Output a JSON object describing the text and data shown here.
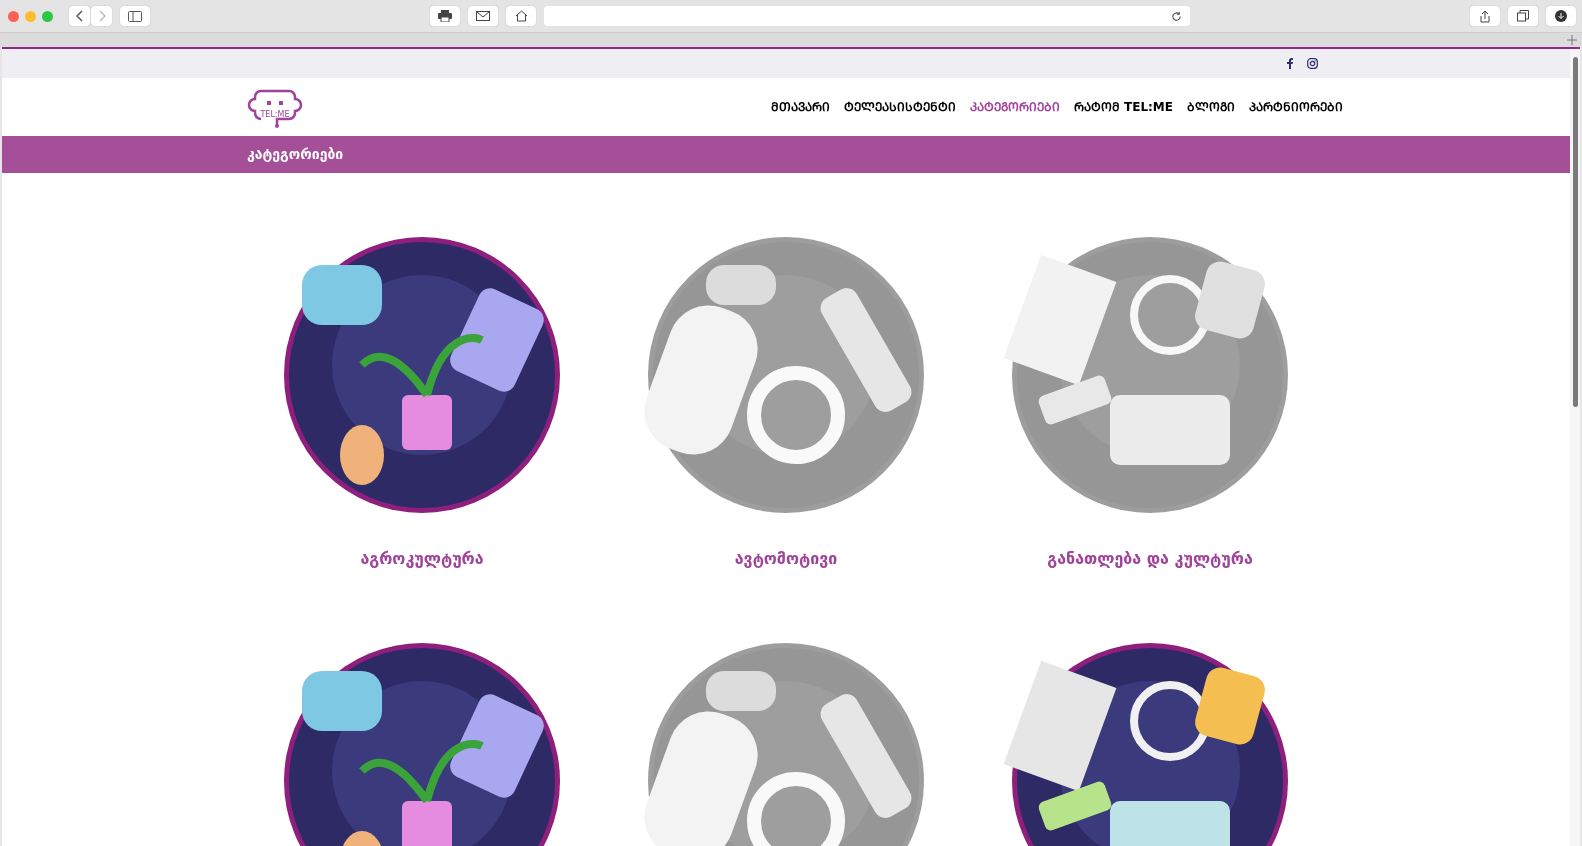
{
  "social": [
    {
      "kind": "facebook"
    },
    {
      "kind": "instagram"
    }
  ],
  "logo": {
    "text": "TEL:ME"
  },
  "nav": [
    {
      "label": "ᲛᲗᲐᲕᲐᲠᲘ",
      "selected": false
    },
    {
      "label": "ᲢᲔᲚᲔᲐᲡᲘᲡᲢᲔᲜᲢᲘ",
      "selected": false
    },
    {
      "label": "ᲙᲐᲢᲔᲒᲝᲠᲘᲔᲑᲘ",
      "selected": true
    },
    {
      "label": "ᲠᲐᲢᲝᲛ TEL:ME",
      "selected": false
    },
    {
      "label": "ᲑᲚᲝᲒᲘ",
      "selected": false
    },
    {
      "label": "ᲞᲐᲠᲢᲜᲘᲝᲠᲔᲑᲘ",
      "selected": false
    }
  ],
  "page_title": "კატეგორიები",
  "categories": [
    {
      "label": "აგროკულტურა",
      "highlighted": true
    },
    {
      "label": "ავტომოტივი",
      "highlighted": false
    },
    {
      "label": "განათლება და კულტურა",
      "highlighted": false
    },
    {
      "highlighted": true
    },
    {
      "highlighted": false
    },
    {
      "highlighted": true
    }
  ]
}
